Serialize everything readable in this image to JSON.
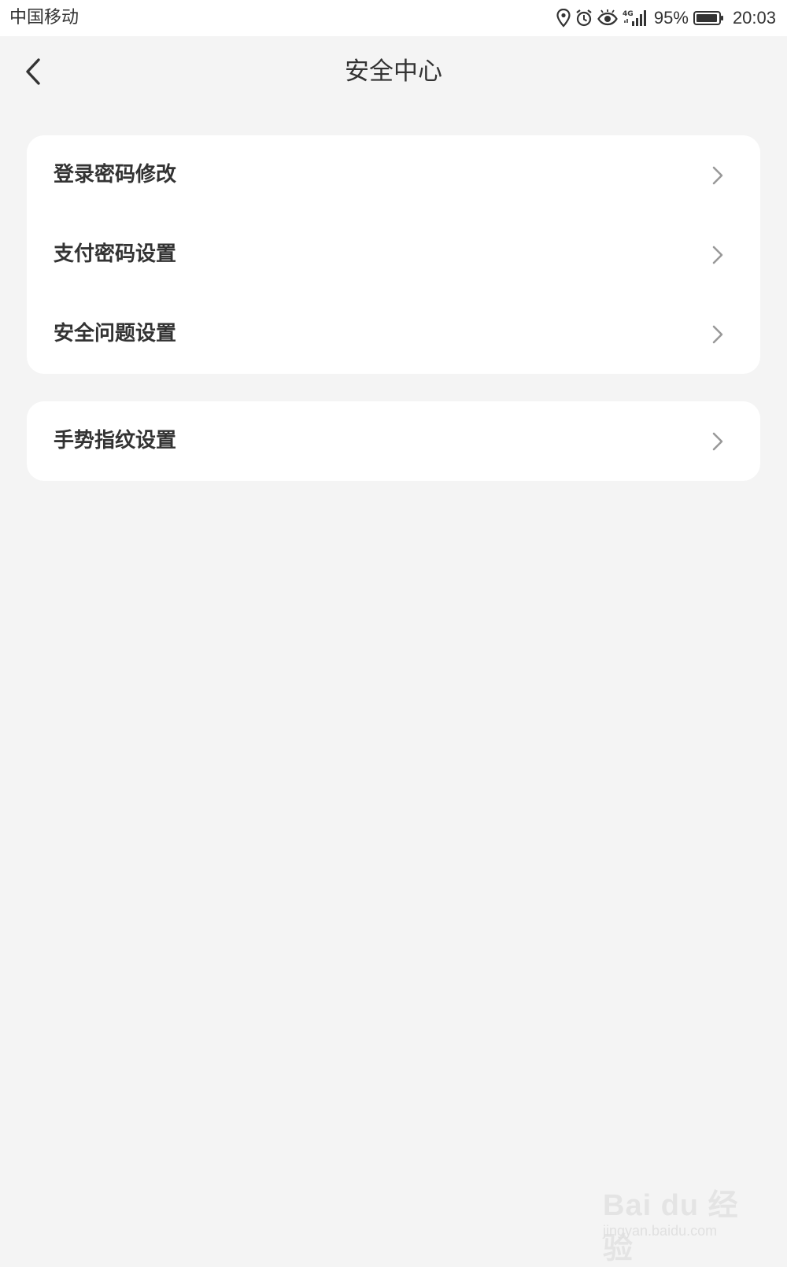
{
  "status_bar": {
    "carrier": "中国移动",
    "network": "4G",
    "battery_percent": "95%",
    "time": "20:03",
    "icons": [
      "location-icon",
      "alarm-icon",
      "eye-icon",
      "signal-icon",
      "battery-icon"
    ]
  },
  "nav": {
    "title": "安全中心",
    "back_icon": "chevron-left-icon"
  },
  "groups": [
    {
      "items": [
        {
          "label": "登录密码修改",
          "icon": "chevron-right-icon"
        },
        {
          "label": "支付密码设置",
          "icon": "chevron-right-icon"
        },
        {
          "label": "安全问题设置",
          "icon": "chevron-right-icon"
        }
      ]
    },
    {
      "items": [
        {
          "label": "手势指纹设置",
          "icon": "chevron-right-icon"
        }
      ]
    }
  ],
  "watermark": {
    "brand": "Bai du 经验",
    "url": "jingyan.baidu.com"
  },
  "colors": {
    "background": "#f4f4f4",
    "card": "#ffffff",
    "text": "#333333",
    "chevron": "#999999"
  }
}
